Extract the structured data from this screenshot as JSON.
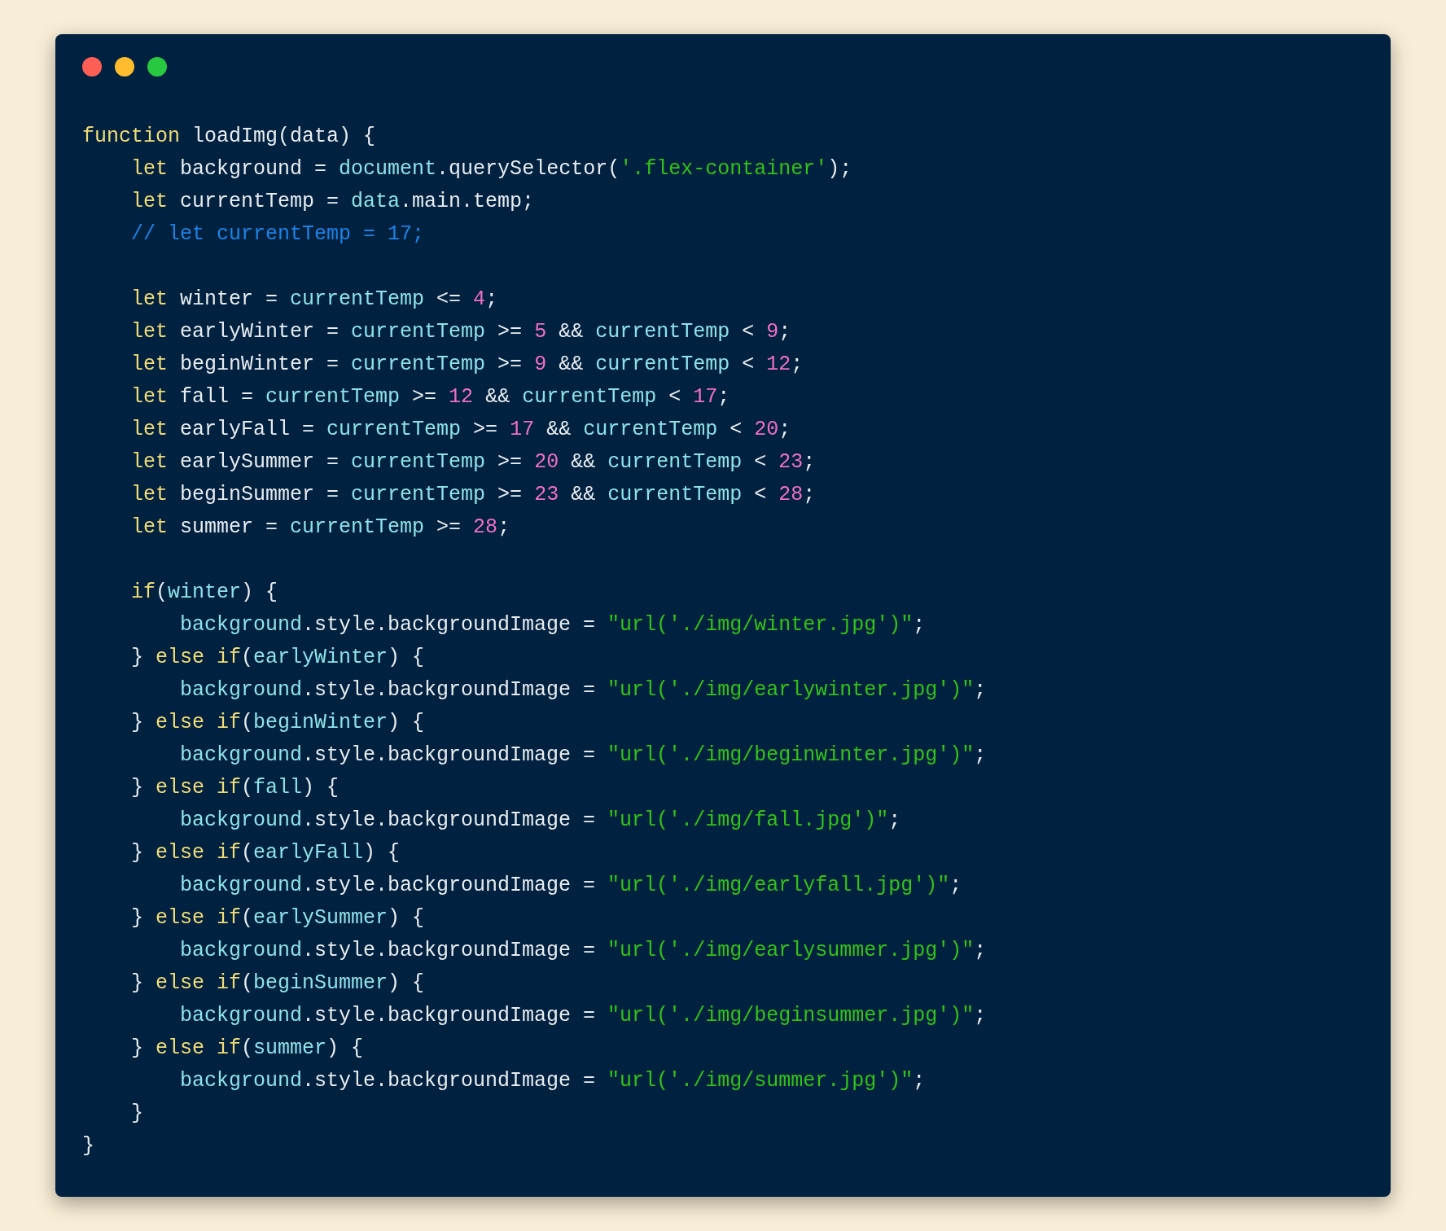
{
  "window": {
    "controls": [
      {
        "kind": "close"
      },
      {
        "kind": "minimize"
      },
      {
        "kind": "maximize"
      }
    ]
  },
  "code_blocks": [
    [
      [
        {
          "kind": "keyword",
          "text": "function"
        },
        {
          "kind": "plain",
          "text": " loadImg(data) {"
        }
      ],
      [
        {
          "kind": "keyword",
          "text": "    let"
        },
        {
          "kind": "plain",
          "text": " background = "
        },
        {
          "kind": "variable",
          "text": "document"
        },
        {
          "kind": "plain",
          "text": ".querySelector("
        },
        {
          "kind": "string",
          "text": "'.flex-container'"
        },
        {
          "kind": "plain",
          "text": ");"
        }
      ],
      [
        {
          "kind": "keyword",
          "text": "    let"
        },
        {
          "kind": "plain",
          "text": " currentTemp = "
        },
        {
          "kind": "variable",
          "text": "data"
        },
        {
          "kind": "plain",
          "text": ".main.temp;"
        }
      ],
      [
        {
          "kind": "comment",
          "text": "    // let currentTemp = 17;"
        }
      ]
    ],
    [
      [
        {
          "kind": "keyword",
          "text": "    let"
        },
        {
          "kind": "plain",
          "text": " winter = "
        },
        {
          "kind": "variable",
          "text": "currentTemp"
        },
        {
          "kind": "plain",
          "text": " <= "
        },
        {
          "kind": "number",
          "text": "4"
        },
        {
          "kind": "plain",
          "text": ";"
        }
      ],
      [
        {
          "kind": "keyword",
          "text": "    let"
        },
        {
          "kind": "plain",
          "text": " earlyWinter = "
        },
        {
          "kind": "variable",
          "text": "currentTemp"
        },
        {
          "kind": "plain",
          "text": " >= "
        },
        {
          "kind": "number",
          "text": "5"
        },
        {
          "kind": "plain",
          "text": " && "
        },
        {
          "kind": "variable",
          "text": "currentTemp"
        },
        {
          "kind": "plain",
          "text": " < "
        },
        {
          "kind": "number",
          "text": "9"
        },
        {
          "kind": "plain",
          "text": ";"
        }
      ],
      [
        {
          "kind": "keyword",
          "text": "    let"
        },
        {
          "kind": "plain",
          "text": " beginWinter = "
        },
        {
          "kind": "variable",
          "text": "currentTemp"
        },
        {
          "kind": "plain",
          "text": " >= "
        },
        {
          "kind": "number",
          "text": "9"
        },
        {
          "kind": "plain",
          "text": " && "
        },
        {
          "kind": "variable",
          "text": "currentTemp"
        },
        {
          "kind": "plain",
          "text": " < "
        },
        {
          "kind": "number",
          "text": "12"
        },
        {
          "kind": "plain",
          "text": ";"
        }
      ],
      [
        {
          "kind": "keyword",
          "text": "    let"
        },
        {
          "kind": "plain",
          "text": " fall = "
        },
        {
          "kind": "variable",
          "text": "currentTemp"
        },
        {
          "kind": "plain",
          "text": " >= "
        },
        {
          "kind": "number",
          "text": "12"
        },
        {
          "kind": "plain",
          "text": " && "
        },
        {
          "kind": "variable",
          "text": "currentTemp"
        },
        {
          "kind": "plain",
          "text": " < "
        },
        {
          "kind": "number",
          "text": "17"
        },
        {
          "kind": "plain",
          "text": ";"
        }
      ],
      [
        {
          "kind": "keyword",
          "text": "    let"
        },
        {
          "kind": "plain",
          "text": " earlyFall = "
        },
        {
          "kind": "variable",
          "text": "currentTemp"
        },
        {
          "kind": "plain",
          "text": " >= "
        },
        {
          "kind": "number",
          "text": "17"
        },
        {
          "kind": "plain",
          "text": " && "
        },
        {
          "kind": "variable",
          "text": "currentTemp"
        },
        {
          "kind": "plain",
          "text": " < "
        },
        {
          "kind": "number",
          "text": "20"
        },
        {
          "kind": "plain",
          "text": ";"
        }
      ],
      [
        {
          "kind": "keyword",
          "text": "    let"
        },
        {
          "kind": "plain",
          "text": " earlySummer = "
        },
        {
          "kind": "variable",
          "text": "currentTemp"
        },
        {
          "kind": "plain",
          "text": " >= "
        },
        {
          "kind": "number",
          "text": "20"
        },
        {
          "kind": "plain",
          "text": " && "
        },
        {
          "kind": "variable",
          "text": "currentTemp"
        },
        {
          "kind": "plain",
          "text": " < "
        },
        {
          "kind": "number",
          "text": "23"
        },
        {
          "kind": "plain",
          "text": ";"
        }
      ],
      [
        {
          "kind": "keyword",
          "text": "    let"
        },
        {
          "kind": "plain",
          "text": " beginSummer = "
        },
        {
          "kind": "variable",
          "text": "currentTemp"
        },
        {
          "kind": "plain",
          "text": " >= "
        },
        {
          "kind": "number",
          "text": "23"
        },
        {
          "kind": "plain",
          "text": " && "
        },
        {
          "kind": "variable",
          "text": "currentTemp"
        },
        {
          "kind": "plain",
          "text": " < "
        },
        {
          "kind": "number",
          "text": "28"
        },
        {
          "kind": "plain",
          "text": ";"
        }
      ],
      [
        {
          "kind": "keyword",
          "text": "    let"
        },
        {
          "kind": "plain",
          "text": " summer = "
        },
        {
          "kind": "variable",
          "text": "currentTemp"
        },
        {
          "kind": "plain",
          "text": " >= "
        },
        {
          "kind": "number",
          "text": "28"
        },
        {
          "kind": "plain",
          "text": ";"
        }
      ]
    ],
    [
      [
        {
          "kind": "keyword",
          "text": "    if"
        },
        {
          "kind": "plain",
          "text": "("
        },
        {
          "kind": "variable",
          "text": "winter"
        },
        {
          "kind": "plain",
          "text": ") {"
        }
      ],
      [
        {
          "kind": "variable",
          "text": "        background"
        },
        {
          "kind": "plain",
          "text": ".style.backgroundImage = "
        },
        {
          "kind": "string",
          "text": "\"url('./img/winter.jpg')\""
        },
        {
          "kind": "plain",
          "text": ";"
        }
      ],
      [
        {
          "kind": "plain",
          "text": "    } "
        },
        {
          "kind": "keyword",
          "text": "else if"
        },
        {
          "kind": "plain",
          "text": "("
        },
        {
          "kind": "variable",
          "text": "earlyWinter"
        },
        {
          "kind": "plain",
          "text": ") {"
        }
      ],
      [
        {
          "kind": "variable",
          "text": "        background"
        },
        {
          "kind": "plain",
          "text": ".style.backgroundImage = "
        },
        {
          "kind": "string",
          "text": "\"url('./img/earlywinter.jpg')\""
        },
        {
          "kind": "plain",
          "text": ";"
        }
      ],
      [
        {
          "kind": "plain",
          "text": "    } "
        },
        {
          "kind": "keyword",
          "text": "else if"
        },
        {
          "kind": "plain",
          "text": "("
        },
        {
          "kind": "variable",
          "text": "beginWinter"
        },
        {
          "kind": "plain",
          "text": ") {"
        }
      ],
      [
        {
          "kind": "variable",
          "text": "        background"
        },
        {
          "kind": "plain",
          "text": ".style.backgroundImage = "
        },
        {
          "kind": "string",
          "text": "\"url('./img/beginwinter.jpg')\""
        },
        {
          "kind": "plain",
          "text": ";"
        }
      ],
      [
        {
          "kind": "plain",
          "text": "    } "
        },
        {
          "kind": "keyword",
          "text": "else if"
        },
        {
          "kind": "plain",
          "text": "("
        },
        {
          "kind": "variable",
          "text": "fall"
        },
        {
          "kind": "plain",
          "text": ") {"
        }
      ],
      [
        {
          "kind": "variable",
          "text": "        background"
        },
        {
          "kind": "plain",
          "text": ".style.backgroundImage = "
        },
        {
          "kind": "string",
          "text": "\"url('./img/fall.jpg')\""
        },
        {
          "kind": "plain",
          "text": ";"
        }
      ],
      [
        {
          "kind": "plain",
          "text": "    } "
        },
        {
          "kind": "keyword",
          "text": "else if"
        },
        {
          "kind": "plain",
          "text": "("
        },
        {
          "kind": "variable",
          "text": "earlyFall"
        },
        {
          "kind": "plain",
          "text": ") {"
        }
      ],
      [
        {
          "kind": "variable",
          "text": "        background"
        },
        {
          "kind": "plain",
          "text": ".style.backgroundImage = "
        },
        {
          "kind": "string",
          "text": "\"url('./img/earlyfall.jpg')\""
        },
        {
          "kind": "plain",
          "text": ";"
        }
      ],
      [
        {
          "kind": "plain",
          "text": "    } "
        },
        {
          "kind": "keyword",
          "text": "else if"
        },
        {
          "kind": "plain",
          "text": "("
        },
        {
          "kind": "variable",
          "text": "earlySummer"
        },
        {
          "kind": "plain",
          "text": ") {"
        }
      ],
      [
        {
          "kind": "variable",
          "text": "        background"
        },
        {
          "kind": "plain",
          "text": ".style.backgroundImage = "
        },
        {
          "kind": "string",
          "text": "\"url('./img/earlysummer.jpg')\""
        },
        {
          "kind": "plain",
          "text": ";"
        }
      ],
      [
        {
          "kind": "plain",
          "text": "    } "
        },
        {
          "kind": "keyword",
          "text": "else if"
        },
        {
          "kind": "plain",
          "text": "("
        },
        {
          "kind": "variable",
          "text": "beginSummer"
        },
        {
          "kind": "plain",
          "text": ") {"
        }
      ],
      [
        {
          "kind": "variable",
          "text": "        background"
        },
        {
          "kind": "plain",
          "text": ".style.backgroundImage = "
        },
        {
          "kind": "string",
          "text": "\"url('./img/beginsummer.jpg')\""
        },
        {
          "kind": "plain",
          "text": ";"
        }
      ],
      [
        {
          "kind": "plain",
          "text": "    } "
        },
        {
          "kind": "keyword",
          "text": "else if"
        },
        {
          "kind": "plain",
          "text": "("
        },
        {
          "kind": "variable",
          "text": "summer"
        },
        {
          "kind": "plain",
          "text": ") {"
        }
      ],
      [
        {
          "kind": "variable",
          "text": "        background"
        },
        {
          "kind": "plain",
          "text": ".style.backgroundImage = "
        },
        {
          "kind": "string",
          "text": "\"url('./img/summer.jpg')\""
        },
        {
          "kind": "plain",
          "text": ";"
        }
      ],
      [
        {
          "kind": "plain",
          "text": "    }"
        }
      ],
      [
        {
          "kind": "plain",
          "text": "}"
        }
      ]
    ]
  ]
}
